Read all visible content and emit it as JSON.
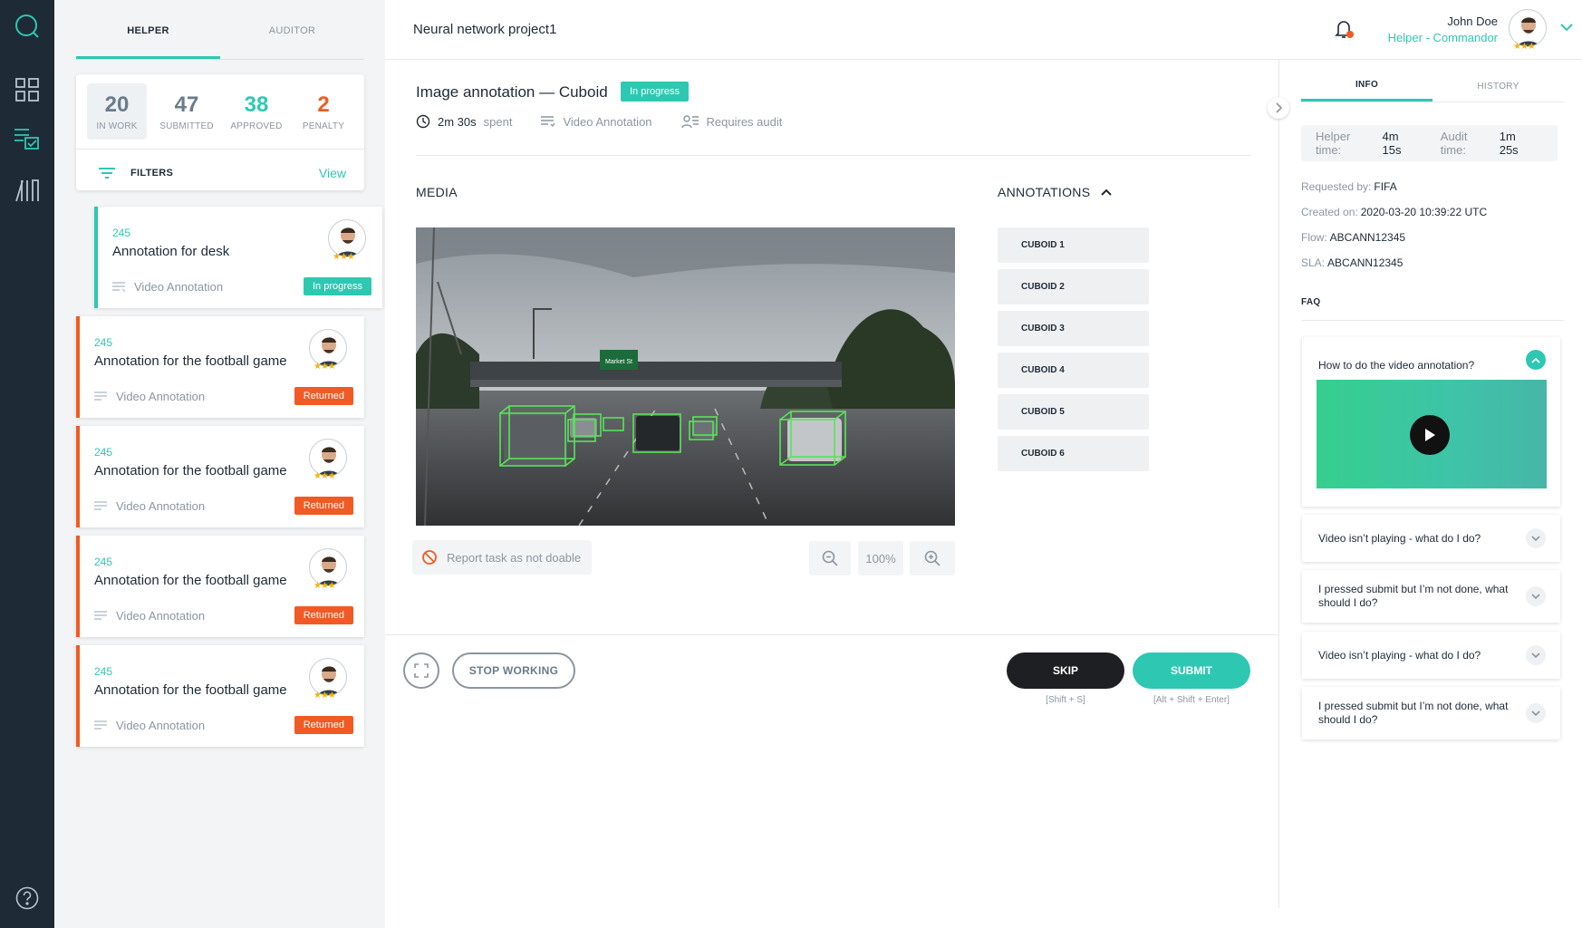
{
  "colors": {
    "accent": "#2ec8b2",
    "returned": "#f15a24",
    "dark": "#1e2b37"
  },
  "nav": {
    "icons": [
      "search-icon",
      "dashboard-icon",
      "tasks-icon",
      "library-icon",
      "help-icon"
    ]
  },
  "list_tabs": [
    "HELPER",
    "AUDITOR"
  ],
  "stats": [
    {
      "value": "20",
      "label": "IN WORK"
    },
    {
      "value": "47",
      "label": "SUBMITTED"
    },
    {
      "value": "38",
      "label": "APPROVED"
    },
    {
      "value": "2",
      "label": "PENALTY"
    }
  ],
  "filters": {
    "label": "FILTERS",
    "view": "View"
  },
  "tasks": [
    {
      "id": "245",
      "title": "Annotation for desk",
      "type": "Video Annotation",
      "status": "In progress",
      "rating": 3
    },
    {
      "id": "245",
      "title": "Annotation for the football game",
      "type": "Video Annotation",
      "status": "Returned",
      "rating": 3
    },
    {
      "id": "245",
      "title": "Annotation for the football game",
      "type": "Video Annotation",
      "status": "Returned",
      "rating": 3
    },
    {
      "id": "245",
      "title": "Annotation for the football game",
      "type": "Video Annotation",
      "status": "Returned",
      "rating": 3
    },
    {
      "id": "245",
      "title": "Annotation for the football game",
      "type": "Video Annotation",
      "status": "Returned",
      "rating": 3
    }
  ],
  "header": {
    "project": "Neural network project1",
    "user_name": "John Doe",
    "user_role": "Helper - Commandor",
    "user_rating": 3
  },
  "task": {
    "title": "Image annotation — Cuboid",
    "status": "In progress",
    "time_value": "2m 30s",
    "time_suffix": "spent",
    "type": "Video Annotation",
    "audit": "Requires audit"
  },
  "media": {
    "label": "MEDIA",
    "sign_text": "Market St",
    "report": "Report task as not doable",
    "zoom": "100%"
  },
  "annotations": {
    "label": "ANNOTATIONS",
    "items": [
      "CUBOID 1",
      "CUBOID 2",
      "CUBOID 3",
      "CUBOID 4",
      "CUBOID 5",
      "CUBOID 6"
    ]
  },
  "actions": {
    "stop": "STOP WORKING",
    "skip": "SKIP",
    "skip_hint": "[Shift + S]",
    "submit": "SUBMIT",
    "submit_hint": "[Alt + Shift + Enter]"
  },
  "info": {
    "tabs": [
      "INFO",
      "HISTORY"
    ],
    "helper_time_label": "Helper time:",
    "helper_time": "4m 15s",
    "audit_time_label": "Audit time:",
    "audit_time": "1m 25s",
    "requested_by_label": "Requested by:",
    "requested_by": "FIFA",
    "created_label": "Created on:",
    "created": "2020-03-20 10:39:22 UTC",
    "flow_label": "Flow:",
    "flow": "ABCANN12345",
    "sla_label": "SLA:",
    "sla": "ABCANN12345"
  },
  "faq": {
    "label": "FAQ",
    "items": [
      {
        "q": "How to do the video annotation?",
        "open": true
      },
      {
        "q": "Video isn’t playing - what do I do?",
        "open": false
      },
      {
        "q": "I pressed submit but I’m not done, what should I do?",
        "open": false
      },
      {
        "q": "Video isn’t playing - what do I do?",
        "open": false
      },
      {
        "q": "I pressed submit but I’m not done, what should I do?",
        "open": false
      }
    ]
  }
}
